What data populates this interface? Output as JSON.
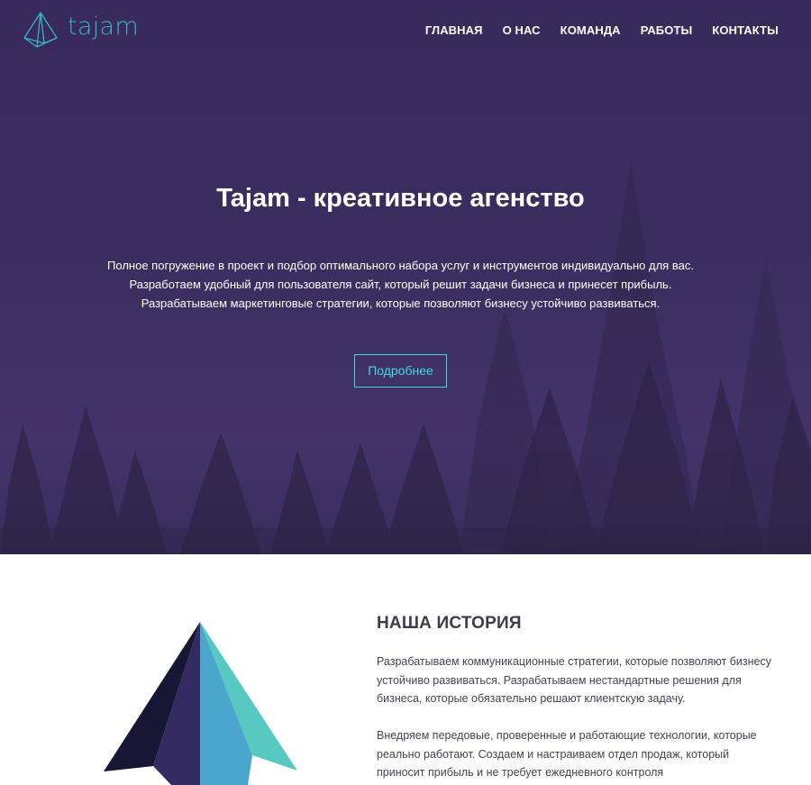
{
  "brand": {
    "name": "tajam"
  },
  "nav": {
    "items": [
      "ГЛАВНАЯ",
      "О НАС",
      "КОМАНДА",
      "РАБОТЫ",
      "КОНТАКТЫ"
    ]
  },
  "hero": {
    "title": "Tajam - креативное агенство",
    "lines": [
      "Полное погружение в проект и подбор оптимального набора услуг и инструментов индивидуально для вас.",
      "Разработаем удобный для пользователя сайт, который решит задачи бизнеса и принесет прибыль.",
      "Разрабатываем маркетинговые стратегии, которые позволяют бизнесу устойчиво развиваться."
    ],
    "button_label": "Подробнее"
  },
  "history": {
    "heading": "НАША ИСТОРИЯ",
    "paragraph1_lines": [
      "Разрабатываем коммуникационные стратегии, которые позволяют бизнесу",
      "устойчиво развиваться. Разрабатываем нестандартные решения для",
      "бизнеса, которые обязательно решают клиентскую задачу."
    ],
    "paragraph2_lines": [
      "Внедряем передовые, проверенные и работающие технологии, которые",
      "реально работают. Создаем и настраиваем отдел продаж, который",
      "приносит прибыль и не требует ежедневного контроля"
    ]
  },
  "colors": {
    "hero_bg": "#3b2d5f",
    "accent": "#40dce3",
    "logo": "#3ab3c3",
    "heading": "#3c3c4a",
    "text": "#44444e"
  },
  "icons": {
    "logo": "pyramid-logo-icon",
    "illustration": "pyramid-illustration"
  }
}
